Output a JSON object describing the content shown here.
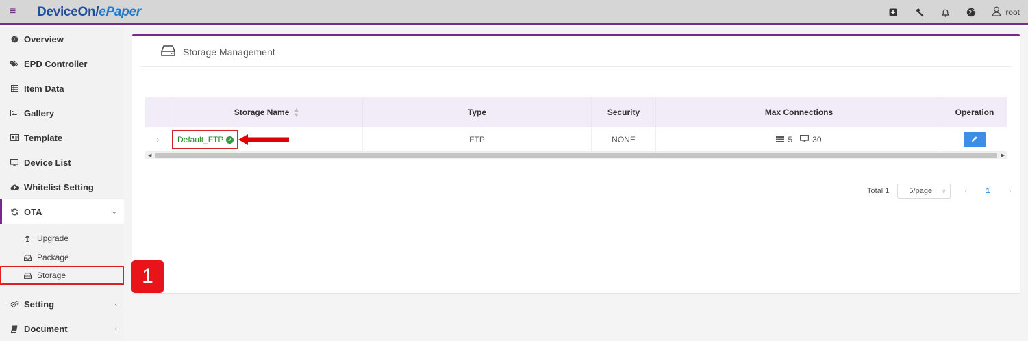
{
  "header": {
    "brand_main": "DeviceOn",
    "brand_slash": "/",
    "brand_sub": "ePaper",
    "user": "root",
    "icons": [
      "menu-icon",
      "add-box-icon",
      "hammer-icon",
      "bell-icon",
      "globe-icon",
      "user-icon"
    ]
  },
  "sidebar": {
    "items": [
      {
        "label": "Overview",
        "icon": "globe-icon"
      },
      {
        "label": "EPD Controller",
        "icon": "tags-icon"
      },
      {
        "label": "Item Data",
        "icon": "table-icon"
      },
      {
        "label": "Gallery",
        "icon": "image-icon"
      },
      {
        "label": "Template",
        "icon": "id-card-icon"
      },
      {
        "label": "Device List",
        "icon": "monitor-icon"
      },
      {
        "label": "Whitelist Setting",
        "icon": "cloud-upload-icon"
      },
      {
        "label": "OTA",
        "icon": "refresh-icon"
      },
      {
        "label": "Setting",
        "icon": "gears-icon"
      },
      {
        "label": "Document",
        "icon": "book-icon"
      }
    ],
    "ota_sub": [
      {
        "label": "Upgrade",
        "icon": "upload-arrow-icon"
      },
      {
        "label": "Package",
        "icon": "inbox-icon"
      },
      {
        "label": "Storage",
        "icon": "hdd-icon"
      }
    ]
  },
  "callout": "1",
  "page": {
    "title": "Storage Management",
    "table": {
      "columns": [
        "Storage Name",
        "Type",
        "Security",
        "Max Connections",
        "Operation"
      ],
      "rows": [
        {
          "name": "Default_FTP",
          "type": "FTP",
          "security": "NONE",
          "conn_servers": "5",
          "conn_devices": "30"
        }
      ]
    },
    "pagination": {
      "total": "Total 1",
      "page_size": "5/page",
      "current_page": "1"
    }
  },
  "colors": {
    "accent": "#7a2a8c",
    "brand": "#1f4e9e",
    "highlight": "#e02020",
    "primary_button": "#3d8ee8",
    "success": "#2e9c3c"
  }
}
